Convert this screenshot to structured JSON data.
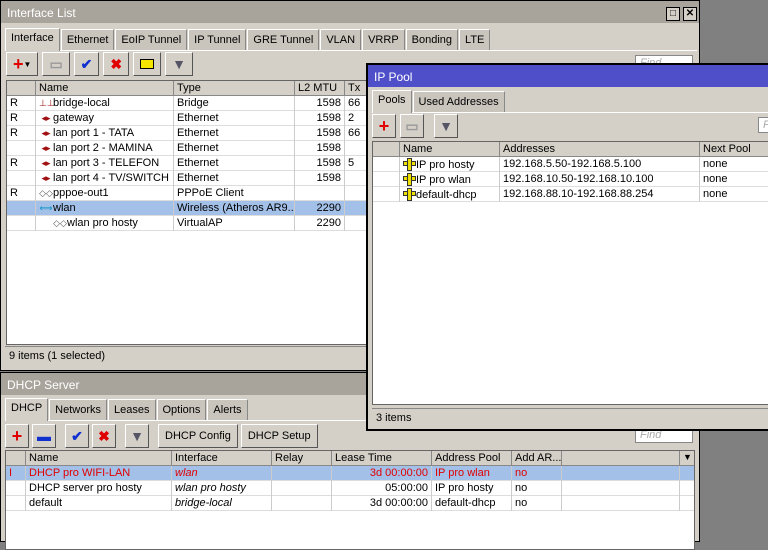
{
  "interface_list": {
    "title": "Interface List",
    "tabs": [
      "Interface",
      "Ethernet",
      "EoIP Tunnel",
      "IP Tunnel",
      "GRE Tunnel",
      "VLAN",
      "VRRP",
      "Bonding",
      "LTE"
    ],
    "find_placeholder": "Find",
    "columns": [
      "",
      "Name",
      "Type",
      "L2 MTU",
      "Tx"
    ],
    "rows": [
      {
        "flag": "R",
        "name": "bridge-local",
        "type": "Bridge",
        "mtu": "1598",
        "tx": "66",
        "icon": "bridge-icon"
      },
      {
        "flag": "R",
        "name": "gateway",
        "type": "Ethernet",
        "mtu": "1598",
        "tx": "2",
        "icon": "ethernet-icon"
      },
      {
        "flag": "R",
        "name": "lan port 1 - TATA",
        "type": "Ethernet",
        "mtu": "1598",
        "tx": "66",
        "icon": "ethernet-icon"
      },
      {
        "flag": "",
        "name": "lan port 2 - MAMINA",
        "type": "Ethernet",
        "mtu": "1598",
        "tx": "",
        "icon": "ethernet-icon"
      },
      {
        "flag": "R",
        "name": "lan port 3 - TELEFON",
        "type": "Ethernet",
        "mtu": "1598",
        "tx": "5",
        "icon": "ethernet-icon"
      },
      {
        "flag": "",
        "name": "lan port 4 - TV/SWITCH",
        "type": "Ethernet",
        "mtu": "1598",
        "tx": "",
        "icon": "ethernet-icon"
      },
      {
        "flag": "R",
        "name": "pppoe-out1",
        "type": "PPPoE Client",
        "mtu": "",
        "tx": "",
        "icon": "pppoe-icon"
      },
      {
        "flag": "",
        "name": "wlan",
        "type": "Wireless (Atheros AR9...",
        "mtu": "2290",
        "tx": "",
        "icon": "wireless-icon",
        "selected": true
      },
      {
        "flag": "",
        "name": "wlan pro hosty",
        "type": "VirtualAP",
        "mtu": "2290",
        "tx": "",
        "icon": "virtualap-icon",
        "indent": true
      }
    ],
    "status": "9 items (1 selected)"
  },
  "ip_pool": {
    "title": "IP Pool",
    "tabs": [
      "Pools",
      "Used Addresses"
    ],
    "find_placeholder": "F",
    "columns": [
      "",
      "Name",
      "Addresses",
      "Next Pool"
    ],
    "rows": [
      {
        "name": "IP pro hosty",
        "addresses": "192.168.5.50-192.168.5.100",
        "next": "none"
      },
      {
        "name": "IP pro wlan",
        "addresses": "192.168.10.50-192.168.10.100",
        "next": "none"
      },
      {
        "name": "default-dhcp",
        "addresses": "192.168.88.10-192.168.88.254",
        "next": "none"
      }
    ],
    "status": "3 items",
    "title_color": "#4f50c9"
  },
  "dhcp_server": {
    "title": "DHCP Server",
    "tabs": [
      "DHCP",
      "Networks",
      "Leases",
      "Options",
      "Alerts"
    ],
    "buttons": {
      "config": "DHCP Config",
      "setup": "DHCP Setup"
    },
    "find_placeholder": "Find",
    "columns": [
      "",
      "Name",
      "Interface",
      "Relay",
      "Lease Time",
      "Address Pool",
      "Add AR..."
    ],
    "rows": [
      {
        "flag": "I",
        "name": "DHCP pro WIFI-LAN",
        "interface": "wlan",
        "relay": "",
        "lease": "3d 00:00:00",
        "pool": "IP pro wlan",
        "add_arp": "no",
        "invalid": true,
        "selected": true
      },
      {
        "flag": "",
        "name": "DHCP server pro hosty",
        "interface": "wlan pro hosty",
        "relay": "",
        "lease": "05:00:00",
        "pool": "IP pro hosty",
        "add_arp": "no"
      },
      {
        "flag": "",
        "name": "default",
        "interface": "bridge-local",
        "relay": "",
        "lease": "3d 00:00:00",
        "pool": "default-dhcp",
        "add_arp": "no"
      }
    ]
  }
}
